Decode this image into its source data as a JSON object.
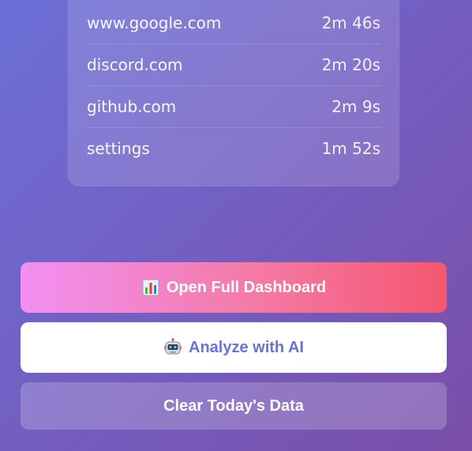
{
  "sites": [
    {
      "domain": "www.google.com",
      "time": "2m 46s"
    },
    {
      "domain": "discord.com",
      "time": "2m 20s"
    },
    {
      "domain": "github.com",
      "time": "2m 9s"
    },
    {
      "domain": "settings",
      "time": "1m 52s"
    }
  ],
  "actions": {
    "dashboard_label": "Open Full Dashboard",
    "dashboard_icon": "bar-chart-icon",
    "ai_label": "Analyze with AI",
    "ai_icon": "robot-icon",
    "clear_label": "Clear Today's Data"
  },
  "colors": {
    "background_start": "#6b6fd6",
    "background_end": "#7a4ea8",
    "dashboard_gradient_start": "#f190f3",
    "dashboard_gradient_end": "#f4576f",
    "ai_text": "#6a72d4"
  }
}
